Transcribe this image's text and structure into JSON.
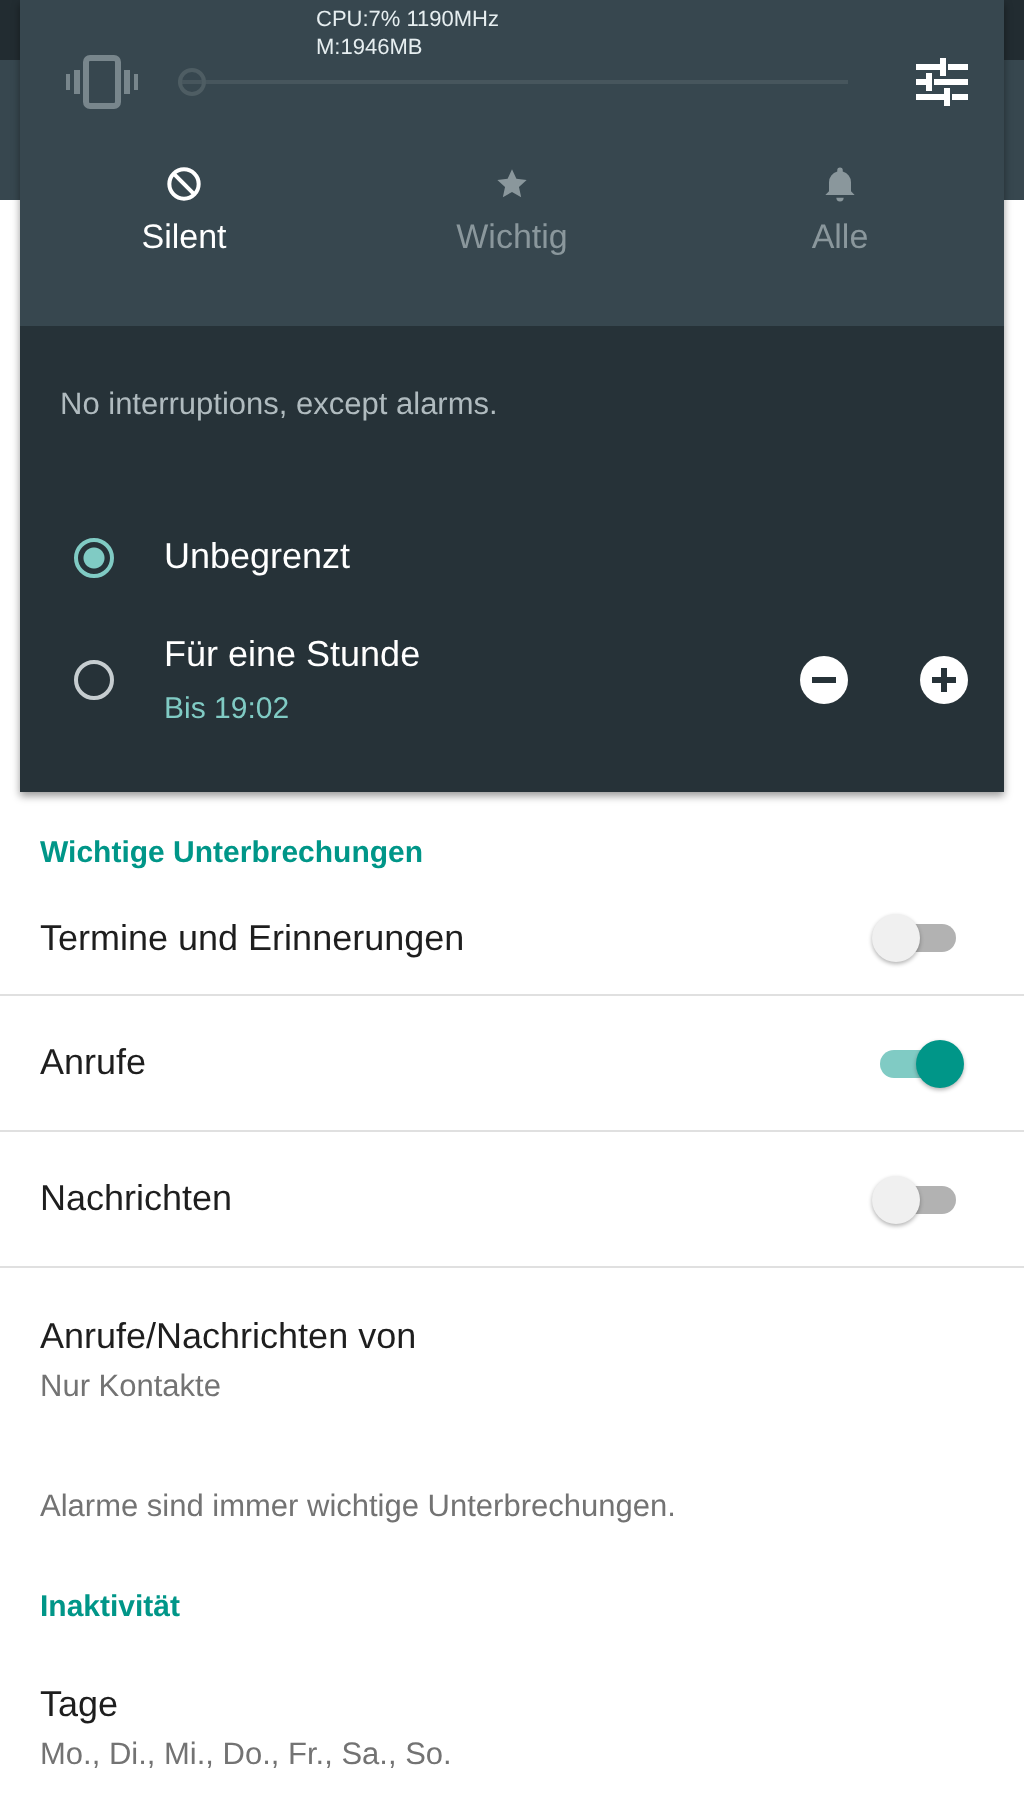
{
  "status_overlay": {
    "cpu": "CPU:7% 1190MHz",
    "memory": "M:1946MB"
  },
  "volume": {
    "level": 0
  },
  "modes": [
    {
      "label": "Silent",
      "selected": true
    },
    {
      "label": "Wichtig",
      "selected": false
    },
    {
      "label": "Alle",
      "selected": false
    }
  ],
  "mode_description": "No interruptions, except alarms.",
  "durations": [
    {
      "label": "Unbegrenzt",
      "selected": true
    },
    {
      "label": "Für eine Stunde",
      "subtitle": "Bis 19:02",
      "selected": false
    }
  ],
  "settings": [
    {
      "kind": "header",
      "title": "Wichtige Unterbrechungen"
    },
    {
      "kind": "toggle",
      "title": "Termine und Erinnerungen",
      "on": false
    },
    {
      "kind": "toggle",
      "title": "Anrufe",
      "on": true
    },
    {
      "kind": "toggle",
      "title": "Nachrichten",
      "on": false
    },
    {
      "kind": "detail",
      "title": "Anrufe/Nachrichten von",
      "summary": "Nur Kontakte"
    },
    {
      "kind": "note",
      "title": "Alarme sind immer wichtige Unterbrechungen."
    },
    {
      "kind": "header",
      "title": "Inaktivität"
    },
    {
      "kind": "detail",
      "title": "Tage",
      "summary": "Mo., Di., Mi., Do., Fr., Sa., So."
    }
  ]
}
